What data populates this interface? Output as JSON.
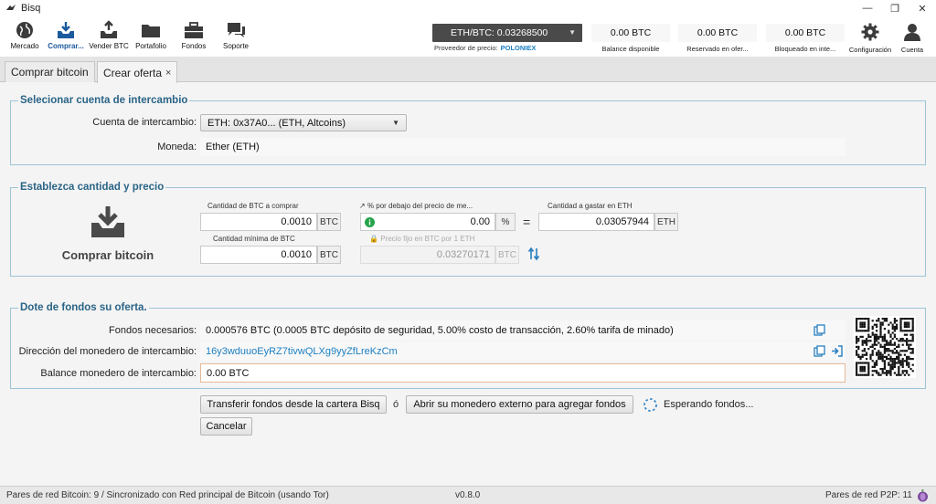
{
  "window": {
    "title": "Bisq"
  },
  "nav": {
    "items": [
      {
        "label": "Mercado",
        "icon": "globe-icon"
      },
      {
        "label": "Comprar...",
        "icon": "buy-bitcoin-icon"
      },
      {
        "label": "Vender BTC",
        "icon": "sell-bitcoin-icon"
      },
      {
        "label": "Portafolio",
        "icon": "folder-icon"
      },
      {
        "label": "Fondos",
        "icon": "briefcase-icon"
      },
      {
        "label": "Soporte",
        "icon": "chat-bubbles-icon"
      }
    ],
    "active_index": 1
  },
  "price": {
    "ticker": "ETH/BTC: 0.03268500",
    "provider_label": "Proveedor de precio:",
    "provider": "POLONIEX"
  },
  "balances": [
    {
      "value": "0.00 BTC",
      "caption": "Balance disponible"
    },
    {
      "value": "0.00 BTC",
      "caption": "Reservado en ofer..."
    },
    {
      "value": "0.00 BTC",
      "caption": "Bloqueado en inte..."
    }
  ],
  "right_nav": {
    "settings": "Configuración",
    "account": "Cuenta"
  },
  "tabs": [
    {
      "label": "Comprar bitcoin"
    },
    {
      "label": "Crear oferta",
      "close": "×"
    }
  ],
  "account_section": {
    "title": "Selecionar cuenta de intercambio",
    "account_label": "Cuenta de intercambio:",
    "account_value": "ETH: 0x37A0... (ETH, Altcoins)",
    "currency_label": "Moneda:",
    "currency_value": "Ether (ETH)"
  },
  "amount_section": {
    "title": "Establezca cantidad y precio",
    "direction_label": "Comprar bitcoin",
    "amount_caption": "Cantidad de BTC a comprar",
    "amount_value": "0.0010",
    "amount_unit": "BTC",
    "percent_caption": "% por debajo del precio de me...",
    "percent_value": "0.00",
    "percent_unit": "%",
    "equals": "=",
    "spend_caption": "Cantidad a gastar en ETH",
    "spend_value": "0.03057944",
    "spend_unit": "ETH",
    "min_caption": "Cantidad mínima de BTC",
    "min_value": "0.0010",
    "min_unit": "BTC",
    "fixed_caption": "Precio fijo en BTC por 1 ETH",
    "fixed_value": "0.03270171",
    "fixed_unit": "BTC"
  },
  "funding_section": {
    "title": "Dote de fondos su oferta.",
    "needed_label": "Fondos necesarios:",
    "needed_value": "0.000576 BTC (0.0005 BTC depósito de seguridad, 5.00% costo de transacción, 2.60% tarifa de minado)",
    "address_label": "Dirección del monedero de intercambio:",
    "address_value": "16y3wduuoEyRZ7tivwQLXg9yyZfLreKzCm",
    "balance_label": "Balance monedero de intercambio:",
    "balance_value": "0.00 BTC"
  },
  "actions": {
    "transfer": "Transferir fondos desde la cartera Bisq",
    "or": "ó",
    "external": "Abrir su monedero externo para agregar fondos",
    "waiting": "Esperando fondos...",
    "cancel": "Cancelar"
  },
  "status": {
    "network": "Pares de red Bitcoin: 9 / Sincronizado con Red principal de Bitcoin (usando Tor)",
    "version": "v0.8.0",
    "p2p": "Pares de red P2P: 11"
  },
  "colors": {
    "accent": "#2a6486",
    "link": "#1b7fc2",
    "border": "#9dc3d6"
  }
}
